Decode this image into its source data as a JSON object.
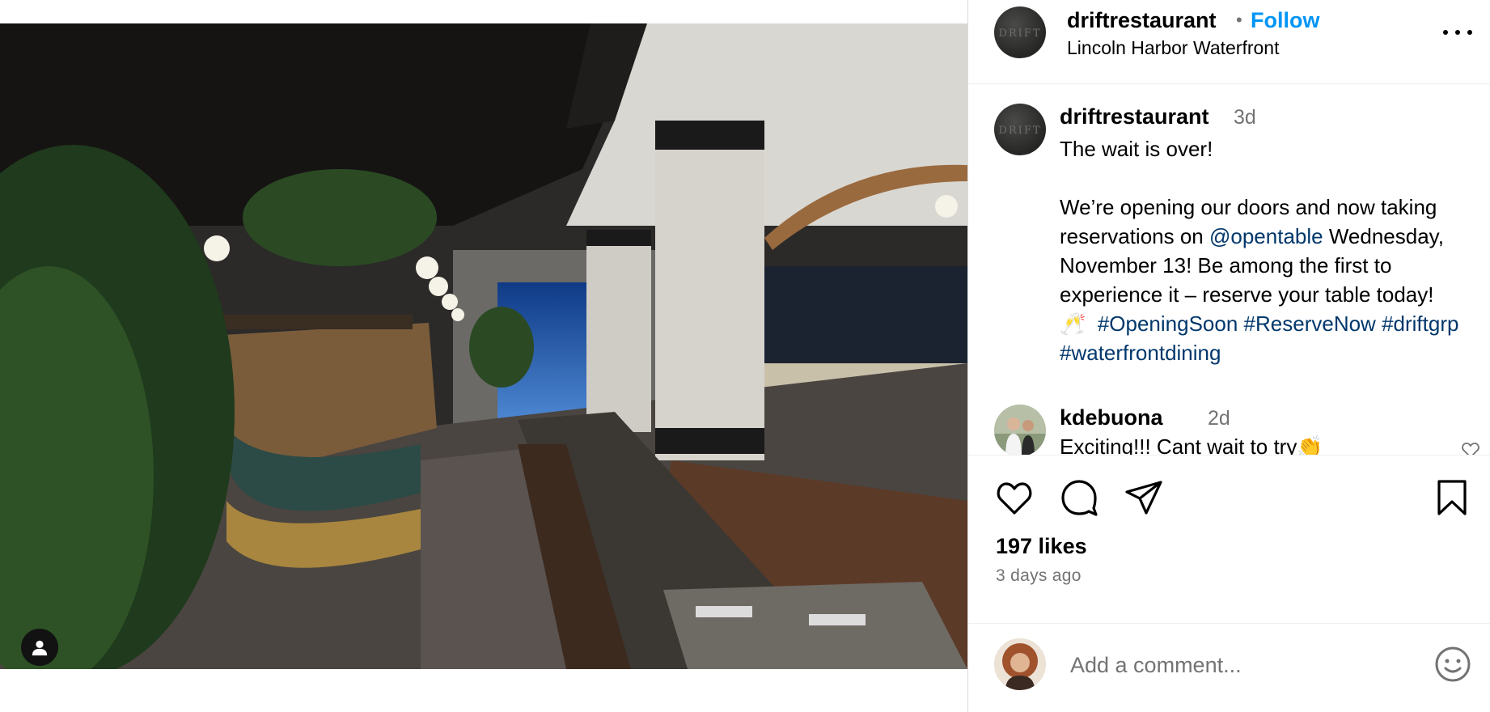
{
  "post": {
    "username": "driftrestaurant",
    "follow_label": "Follow",
    "separator": "•",
    "location": "Lincoln Harbor Waterfront",
    "avatar_text": "DRIFT"
  },
  "caption": {
    "username": "driftrestaurant",
    "time": "3d",
    "line1": "The wait is over!",
    "line2_a": "We’re opening our doors and now taking reservations on ",
    "mention": "@opentable",
    "line2_b": " Wednesday, November 13! Be among the first to experience it – reserve your table today!",
    "emoji": "🥂",
    "hashtags": [
      "#OpeningSoon",
      "#ReserveNow",
      "#driftgrp",
      "#waterfrontdining"
    ]
  },
  "comment": {
    "username": "kdebuona",
    "time": "2d",
    "text": "Exciting!!! Cant wait to try👏"
  },
  "stats": {
    "likes": "197 likes",
    "date": "3 days ago"
  },
  "add_comment": {
    "placeholder": "Add a comment..."
  },
  "icons": {
    "like": "heart-icon",
    "comment": "comment-bubble-icon",
    "share": "paper-plane-icon",
    "save": "bookmark-icon",
    "more": "more-horizontal-icon",
    "user_tag": "user-tag-icon",
    "emoji": "emoji-smile-icon"
  },
  "colors": {
    "follow": "#0095f6",
    "link": "#00376b",
    "secondary_text": "#737373"
  }
}
